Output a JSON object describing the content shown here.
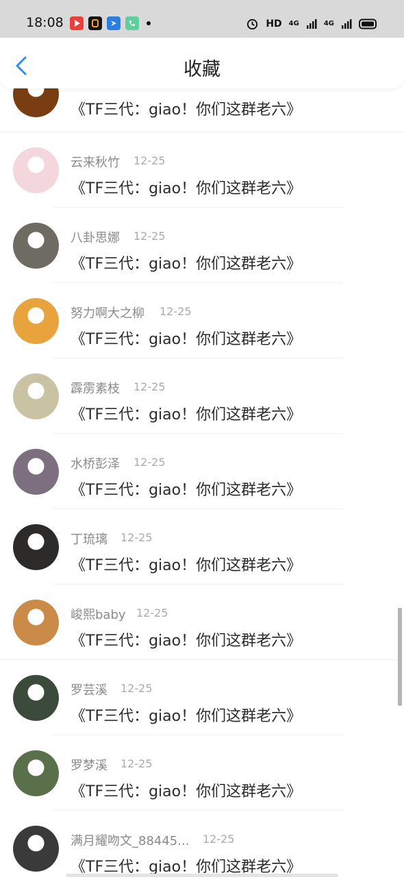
{
  "status": {
    "time": "18:08",
    "hd": "HD",
    "net1": "4G",
    "net2": "4G"
  },
  "header": {
    "title": "收藏"
  },
  "items": [
    {
      "name": "",
      "date": "",
      "text": "《TF三代：giao！你们这群老六》"
    },
    {
      "name": "云来秋竹",
      "date": "12-25",
      "text": "《TF三代：giao！你们这群老六》"
    },
    {
      "name": "八卦思娜",
      "date": "12-25",
      "text": "《TF三代：giao！你们这群老六》"
    },
    {
      "name": "努力啊大之柳",
      "date": "12-25",
      "text": "《TF三代：giao！你们这群老六》"
    },
    {
      "name": "霹雳素枝",
      "date": "12-25",
      "text": "《TF三代：giao！你们这群老六》"
    },
    {
      "name": "水桥彭泽",
      "date": "12-25",
      "text": "《TF三代：giao！你们这群老六》"
    },
    {
      "name": "丁琉璃",
      "date": "12-25",
      "text": "《TF三代：giao！你们这群老六》"
    },
    {
      "name": "峻熙baby",
      "date": "12-25",
      "text": "《TF三代：giao！你们这群老六》"
    },
    {
      "name": "罗芸溪",
      "date": "12-25",
      "text": "《TF三代：giao！你们这群老六》"
    },
    {
      "name": "罗梦溪",
      "date": "12-25",
      "text": "《TF三代：giao！你们这群老六》"
    },
    {
      "name": "满月耀吻文_88445...",
      "date": "12-25",
      "text": "《TF三代：giao！你们这群老六》"
    }
  ],
  "avatar_colors": [
    "#7a3d12",
    "#f3d7dc",
    "#6e6b62",
    "#e8a33c",
    "#c9c3a4",
    "#7d6f80",
    "#2d2a2a",
    "#c98b47",
    "#3b4a3a",
    "#59704a",
    "#3a3a3a"
  ],
  "accent": "#2f8fe8"
}
